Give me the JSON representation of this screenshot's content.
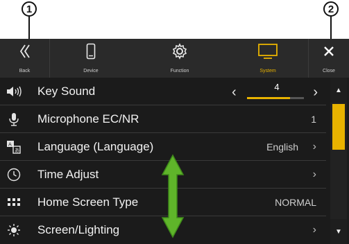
{
  "callouts": [
    "1",
    "2"
  ],
  "topbar": {
    "back": {
      "label": "Back",
      "icon": "double-chevron-left-icon"
    },
    "device": {
      "label": "Device",
      "icon": "phone-icon"
    },
    "function": {
      "label": "Function",
      "icon": "gear-icon"
    },
    "system": {
      "label": "System",
      "icon": "monitor-icon",
      "active": true
    },
    "close": {
      "label": "Close",
      "icon": "close-icon"
    }
  },
  "rows": [
    {
      "label": "Key Sound",
      "icon": "speaker-icon",
      "value": "4",
      "level": 0.75
    },
    {
      "label": "Microphone EC/NR",
      "icon": "microphone-icon",
      "value": "1"
    },
    {
      "label": "Language (Language)",
      "icon": "language-icon",
      "value": "English"
    },
    {
      "label": "Time Adjust",
      "icon": "clock-icon",
      "value": ""
    },
    {
      "label": "Home Screen Type",
      "icon": "grid-icon",
      "value": "NORMAL"
    },
    {
      "label": "Screen/Lighting",
      "icon": "brightness-icon",
      "value": ""
    }
  ],
  "scrollbar": {
    "up": "▲",
    "down": "▼"
  },
  "colors": {
    "accent": "#e9b300",
    "background": "#1b1b1b",
    "arrow": "#5fb52a"
  }
}
